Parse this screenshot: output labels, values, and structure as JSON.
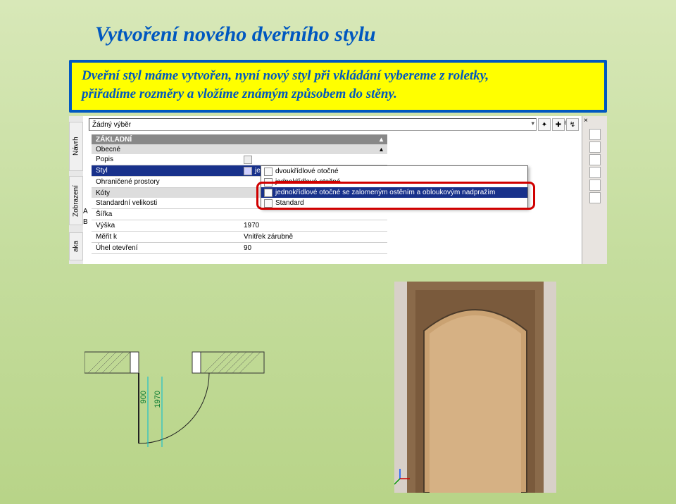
{
  "title": "Vytvoření nového dveřního stylu",
  "callout": {
    "line1": "Dveřní styl máme vytvořen, nyní nový styl při vkládání vybereme z roletky,",
    "line2": "přiřadíme rozměry a vložíme známým způsobem do stěny."
  },
  "ui": {
    "side_tabs": [
      "Návrh",
      "Zobrazení",
      "aka"
    ],
    "top_combo": "Žádný výběr",
    "right_label": "DleHla",
    "section": "ZÁKLADNÍ",
    "subsection1": "Obecné",
    "subsection2": "Kóty",
    "ab": {
      "a": "A",
      "b": "B"
    },
    "props": {
      "popis": {
        "k": "Popis",
        "v": ""
      },
      "styl": {
        "k": "Styl",
        "v": "jednokřídlové otočné se zalomeným o..."
      },
      "ohranicene": {
        "k": "Ohraničené prostory",
        "v": ""
      },
      "stdvel": {
        "k": "Standardní velikosti",
        "v": ""
      },
      "sirka": {
        "k": "Šířka",
        "v": ""
      },
      "vyska": {
        "k": "Výška",
        "v": "1970"
      },
      "merit": {
        "k": "Měřit k",
        "v": "Vnitřek zárubně"
      },
      "uhel": {
        "k": "Úhel otevření",
        "v": "90"
      }
    },
    "dropdown": [
      "dvoukřídlové otočné",
      "jednokřídlové otočné",
      "jednokřídlové otočné se zalomeným ostěním a obloukovým nadpražím",
      "Standard"
    ],
    "caret": "▴"
  },
  "plan": {
    "dim1": "900",
    "dim2": "1970"
  }
}
